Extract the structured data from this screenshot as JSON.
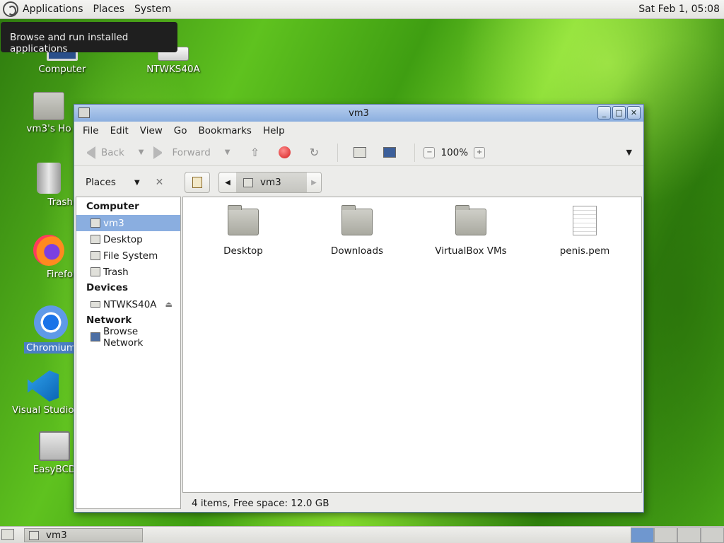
{
  "top_panel": {
    "menus": [
      "Applications",
      "Places",
      "System"
    ],
    "clock": "Sat Feb  1, 05:08"
  },
  "tooltip": "Browse and run installed applications",
  "desktop_icons": [
    {
      "label": "Computer",
      "icon": "computer-icon"
    },
    {
      "label": "NTWKS40A",
      "icon": "drive-icon"
    },
    {
      "label": "vm3's Ho",
      "icon": "home-folder-icon"
    },
    {
      "label": "Trash",
      "icon": "trash-icon"
    },
    {
      "label": "Firefo",
      "icon": "firefox-icon"
    },
    {
      "label": "Chromium",
      "icon": "chromium-icon"
    },
    {
      "label": "Visual Studio C",
      "icon": "vscode-icon"
    },
    {
      "label": "EasyBCD",
      "icon": "easybcd-icon"
    }
  ],
  "window": {
    "title": "vm3",
    "menubar": [
      "File",
      "Edit",
      "View",
      "Go",
      "Bookmarks",
      "Help"
    ],
    "toolbar": {
      "back": "Back",
      "forward": "Forward",
      "zoom": "100%"
    },
    "sidebar": {
      "header": "Places",
      "sections": [
        {
          "title": "Computer",
          "items": [
            "vm3",
            "Desktop",
            "File System",
            "Trash"
          ]
        },
        {
          "title": "Devices",
          "items": [
            "NTWKS40A"
          ]
        },
        {
          "title": "Network",
          "items": [
            "Browse Network"
          ]
        }
      ]
    },
    "location": "vm3",
    "files": [
      {
        "name": "Desktop",
        "type": "folder"
      },
      {
        "name": "Downloads",
        "type": "folder"
      },
      {
        "name": "VirtualBox VMs",
        "type": "folder"
      },
      {
        "name": "penis.pem",
        "type": "file"
      }
    ],
    "status": "4 items, Free space: 12.0 GB"
  },
  "taskbar": {
    "task": "vm3"
  },
  "colors": {
    "selection": "#8aaee0",
    "titlebar": "#9fbde6",
    "desktop": "#4aa818"
  }
}
